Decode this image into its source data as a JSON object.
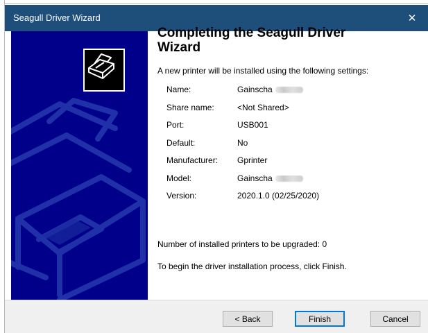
{
  "window": {
    "title": "Seagull Driver Wizard",
    "close_glyph": "✕"
  },
  "heading": "Completing the Seagull Driver Wizard",
  "intro": "A new printer will be installed using the following settings:",
  "settings": [
    {
      "key": "Name:",
      "value": "Gainscha",
      "redacted": true
    },
    {
      "key": "Share name:",
      "value": "<Not Shared>"
    },
    {
      "key": "Port:",
      "value": "USB001"
    },
    {
      "key": "Default:",
      "value": "No"
    },
    {
      "key": "Manufacturer:",
      "value": "Gprinter"
    },
    {
      "key": "Model:",
      "value": "Gainscha",
      "redacted": true
    },
    {
      "key": "Version:",
      "value": "2020.1.0 (02/25/2020)"
    }
  ],
  "upgrade_text": "Number of installed printers to be upgraded: 0",
  "finish_text": "To begin the driver installation process, click Finish.",
  "buttons": {
    "back": "< Back",
    "finish": "Finish",
    "cancel": "Cancel"
  },
  "colors": {
    "titlebar": "#1e4e7a",
    "banner": "#00008a",
    "accent": "#0078d7"
  },
  "icons": {
    "banner_art": "printer-outline-icon",
    "logo": "printer-logo-icon",
    "close": "close-icon"
  }
}
